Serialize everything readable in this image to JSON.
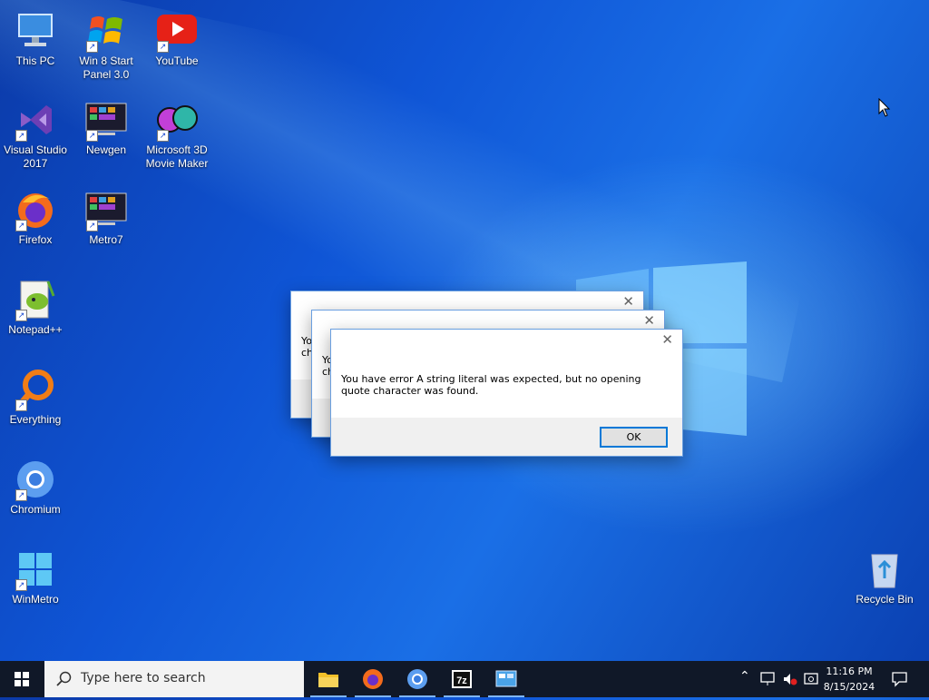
{
  "desktop_icons": [
    {
      "name": "This PC",
      "line2": ""
    },
    {
      "name": "Win 8 Start",
      "line2": "Panel 3.0"
    },
    {
      "name": "YouTube",
      "line2": ""
    },
    {
      "name": "Visual Studio",
      "line2": "2017"
    },
    {
      "name": "Newgen",
      "line2": ""
    },
    {
      "name": "Microsoft 3D",
      "line2": "Movie Maker"
    },
    {
      "name": "Firefox",
      "line2": ""
    },
    {
      "name": "Metro7",
      "line2": ""
    },
    {
      "name": "Notepad++",
      "line2": ""
    },
    {
      "name": "Everything",
      "line2": ""
    },
    {
      "name": "Chromium",
      "line2": ""
    },
    {
      "name": "WinMetro",
      "line2": ""
    },
    {
      "name": "Recycle Bin",
      "line2": ""
    }
  ],
  "dialogs": {
    "back1_text_a": "Yo",
    "back1_text_b": "ch",
    "back2_text_a": "Yo",
    "back2_text_b": "ch",
    "front_message": "You have error A string literal was expected, but no opening quote character was found.",
    "ok_label": "OK",
    "close_glyph": "✕"
  },
  "taskbar": {
    "search_placeholder": "Type here to search",
    "time": "11:16 PM",
    "date": "8/15/2024",
    "apps": [
      "File Explorer",
      "Firefox",
      "Chromium",
      "7-Zip",
      "Control Panel"
    ]
  },
  "colors": {
    "accent": "#0078d7",
    "taskbar": "#101828"
  }
}
